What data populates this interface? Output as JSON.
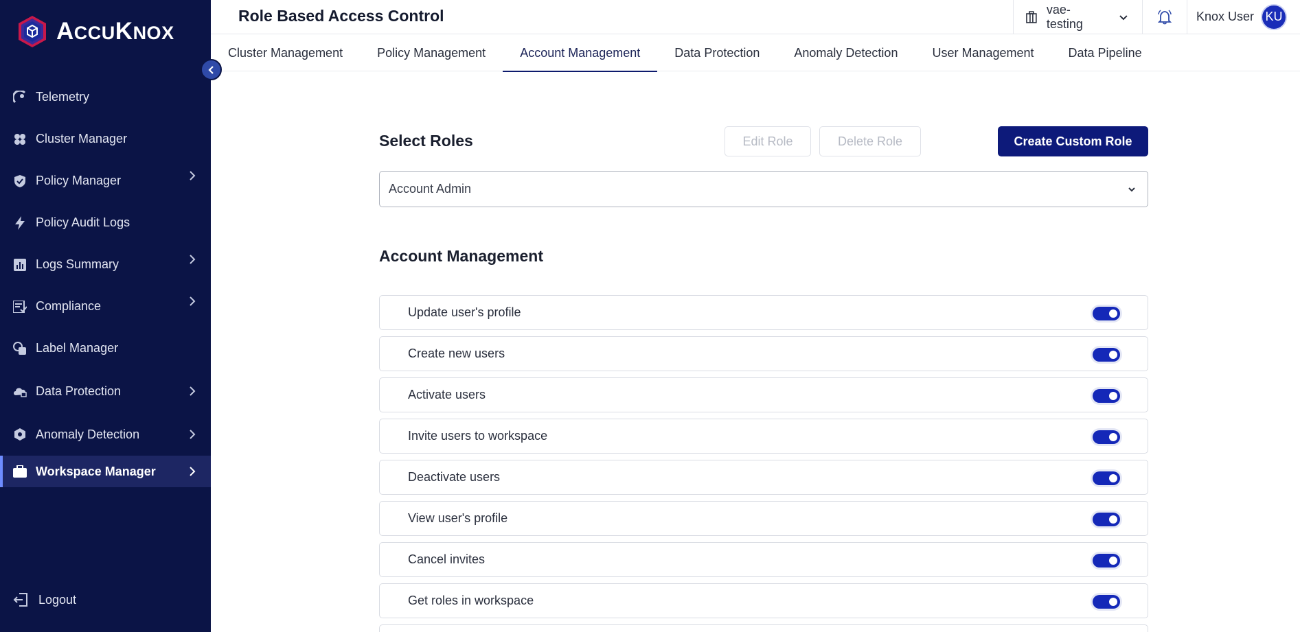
{
  "brand": {
    "name_big": "A",
    "name_small_1": "CCU",
    "name_big_2": "K",
    "name_small_2": "NOX"
  },
  "sidebar": {
    "items": [
      {
        "label": "Telemetry",
        "icon": "telemetry-icon",
        "has_chevron": false
      },
      {
        "label": "Cluster Manager",
        "icon": "cluster-icon",
        "has_chevron": false
      },
      {
        "label": "Policy Manager",
        "icon": "shield-icon",
        "has_chevron": true
      },
      {
        "label": "Policy Audit Logs",
        "icon": "lightning-icon",
        "has_chevron": false
      },
      {
        "label": "Logs Summary",
        "icon": "bar-chart-icon",
        "has_chevron": true
      },
      {
        "label": "Compliance",
        "icon": "checklist-icon",
        "has_chevron": true
      },
      {
        "label": "Label Manager",
        "icon": "label-icon",
        "has_chevron": false
      },
      {
        "label": "Data Protection",
        "icon": "cloud-lock-icon",
        "has_chevron": true
      },
      {
        "label": "Anomaly Detection",
        "icon": "anomaly-icon",
        "has_chevron": true
      },
      {
        "label": "Workspace Manager",
        "icon": "briefcase-icon",
        "has_chevron": true,
        "active": true
      }
    ],
    "logout_label": "Logout"
  },
  "header": {
    "title": "Role Based Access Control",
    "workspace": "vae-testing",
    "user_name": "Knox User",
    "user_initials": "KU"
  },
  "tabs": [
    {
      "label": "Cluster Management"
    },
    {
      "label": "Policy Management"
    },
    {
      "label": "Account Management",
      "active": true
    },
    {
      "label": "Data Protection"
    },
    {
      "label": "Anomaly Detection"
    },
    {
      "label": "User Management"
    },
    {
      "label": "Data Pipeline"
    }
  ],
  "roles": {
    "title": "Select Roles",
    "edit_label": "Edit Role",
    "delete_label": "Delete Role",
    "create_label": "Create Custom Role",
    "selected_role": "Account Admin"
  },
  "section": {
    "title": "Account Management",
    "permissions": [
      {
        "label": "Update user's profile",
        "enabled": true
      },
      {
        "label": "Create new users",
        "enabled": true
      },
      {
        "label": "Activate users",
        "enabled": true
      },
      {
        "label": "Invite users to workspace",
        "enabled": true
      },
      {
        "label": "Deactivate users",
        "enabled": true
      },
      {
        "label": "View user's profile",
        "enabled": true
      },
      {
        "label": "Cancel invites",
        "enabled": true
      },
      {
        "label": "Get roles in workspace",
        "enabled": true
      }
    ]
  },
  "colors": {
    "sidebar_bg": "#0b1446",
    "primary": "#0d1a7a",
    "toggle_on": "#1428b8"
  }
}
